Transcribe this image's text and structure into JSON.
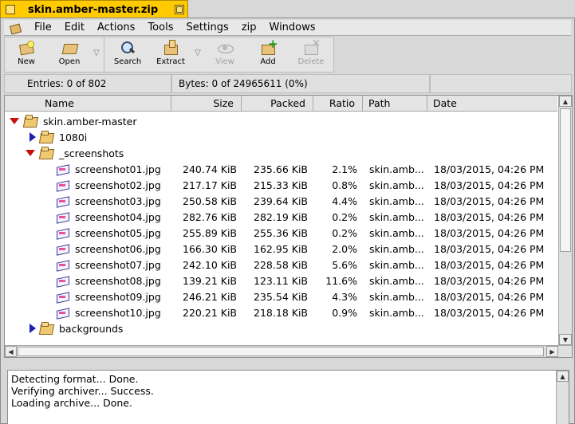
{
  "window": {
    "title": "skin.amber-master.zip"
  },
  "menu": [
    "File",
    "Edit",
    "Actions",
    "Tools",
    "Settings",
    "zip",
    "Windows"
  ],
  "toolbar": {
    "new": "New",
    "open": "Open",
    "search": "Search",
    "extract": "Extract",
    "view": "View",
    "add": "Add",
    "delete": "Delete",
    "dropdown_glyph": "▽"
  },
  "info": {
    "entries": "Entries: 0 of 802",
    "bytes": "Bytes: 0 of 24965611 (0%)"
  },
  "columns": {
    "name": "Name",
    "size": "Size",
    "packed": "Packed",
    "ratio": "Ratio",
    "path": "Path",
    "date": "Date"
  },
  "tree": {
    "root": "skin.amber-master",
    "folder_1080i": "1080i",
    "folder_screenshots": "_screenshots",
    "folder_backgrounds": "backgrounds"
  },
  "files": [
    {
      "name": "screenshot01.jpg",
      "size": "240.74 KiB",
      "packed": "235.66 KiB",
      "ratio": "2.1%",
      "path": "skin.amb...",
      "date": "18/03/2015, 04:26 PM"
    },
    {
      "name": "screenshot02.jpg",
      "size": "217.17 KiB",
      "packed": "215.33 KiB",
      "ratio": "0.8%",
      "path": "skin.amb...",
      "date": "18/03/2015, 04:26 PM"
    },
    {
      "name": "screenshot03.jpg",
      "size": "250.58 KiB",
      "packed": "239.64 KiB",
      "ratio": "4.4%",
      "path": "skin.amb...",
      "date": "18/03/2015, 04:26 PM"
    },
    {
      "name": "screenshot04.jpg",
      "size": "282.76 KiB",
      "packed": "282.19 KiB",
      "ratio": "0.2%",
      "path": "skin.amb...",
      "date": "18/03/2015, 04:26 PM"
    },
    {
      "name": "screenshot05.jpg",
      "size": "255.89 KiB",
      "packed": "255.36 KiB",
      "ratio": "0.2%",
      "path": "skin.amb...",
      "date": "18/03/2015, 04:26 PM"
    },
    {
      "name": "screenshot06.jpg",
      "size": "166.30 KiB",
      "packed": "162.95 KiB",
      "ratio": "2.0%",
      "path": "skin.amb...",
      "date": "18/03/2015, 04:26 PM"
    },
    {
      "name": "screenshot07.jpg",
      "size": "242.10 KiB",
      "packed": "228.58 KiB",
      "ratio": "5.6%",
      "path": "skin.amb...",
      "date": "18/03/2015, 04:26 PM"
    },
    {
      "name": "screenshot08.jpg",
      "size": "139.21 KiB",
      "packed": "123.11 KiB",
      "ratio": "11.6%",
      "path": "skin.amb...",
      "date": "18/03/2015, 04:26 PM"
    },
    {
      "name": "screenshot09.jpg",
      "size": "246.21 KiB",
      "packed": "235.54 KiB",
      "ratio": "4.3%",
      "path": "skin.amb...",
      "date": "18/03/2015, 04:26 PM"
    },
    {
      "name": "screenshot10.jpg",
      "size": "220.21 KiB",
      "packed": "218.18 KiB",
      "ratio": "0.9%",
      "path": "skin.amb...",
      "date": "18/03/2015, 04:26 PM"
    }
  ],
  "log": [
    "Detecting format... Done.",
    "Verifying archiver... Success.",
    "Loading archive... Done."
  ],
  "icons": {
    "expanded": "triangle-down-red",
    "collapsed": "triangle-right-blue",
    "folder": "folder-icon",
    "file": "image-file-icon"
  },
  "colors": {
    "title_tab": "#ffcb00",
    "expanded_triangle": "#c81010",
    "collapsed_triangle": "#2020b0"
  }
}
